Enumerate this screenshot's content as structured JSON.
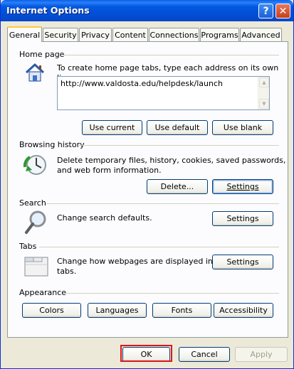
{
  "window": {
    "title": "Internet Options"
  },
  "titlebar": {
    "help_label": "?",
    "close_label": "✕"
  },
  "tabs": [
    {
      "label": "General",
      "active": true
    },
    {
      "label": "Security"
    },
    {
      "label": "Privacy"
    },
    {
      "label": "Content"
    },
    {
      "label": "Connections"
    },
    {
      "label": "Programs"
    },
    {
      "label": "Advanced"
    }
  ],
  "home_page": {
    "label": "Home page",
    "description": "To create home page tabs, type each address on its own line.",
    "url_value": "http://www.valdosta.edu/helpdesk/launch",
    "use_current": "Use current",
    "use_default": "Use default",
    "use_blank": "Use blank",
    "icon": "house-icon"
  },
  "browsing_history": {
    "label": "Browsing history",
    "description_line1": "Delete temporary files, history, cookies, saved passwords,",
    "description_line2": "and web form information.",
    "delete_label": "Delete...",
    "settings_label": "Settings",
    "icon": "history-clock-icon"
  },
  "search": {
    "label": "Search",
    "description": "Change search defaults.",
    "settings_label": "Settings",
    "icon": "magnifier-icon"
  },
  "tabs_section": {
    "label": "Tabs",
    "description_line1": "Change how webpages are displayed in",
    "description_line2": "tabs.",
    "settings_label": "Settings",
    "icon": "tabs-window-icon"
  },
  "appearance": {
    "label": "Appearance",
    "colors": "Colors",
    "languages": "Languages",
    "fonts": "Fonts",
    "accessibility": "Accessibility"
  },
  "footer": {
    "ok": "OK",
    "cancel": "Cancel",
    "apply": "Apply"
  },
  "colors": {
    "titlebar": "#0050d8",
    "highlight": "#e0151c",
    "dialog_bg": "#ece9d8"
  }
}
